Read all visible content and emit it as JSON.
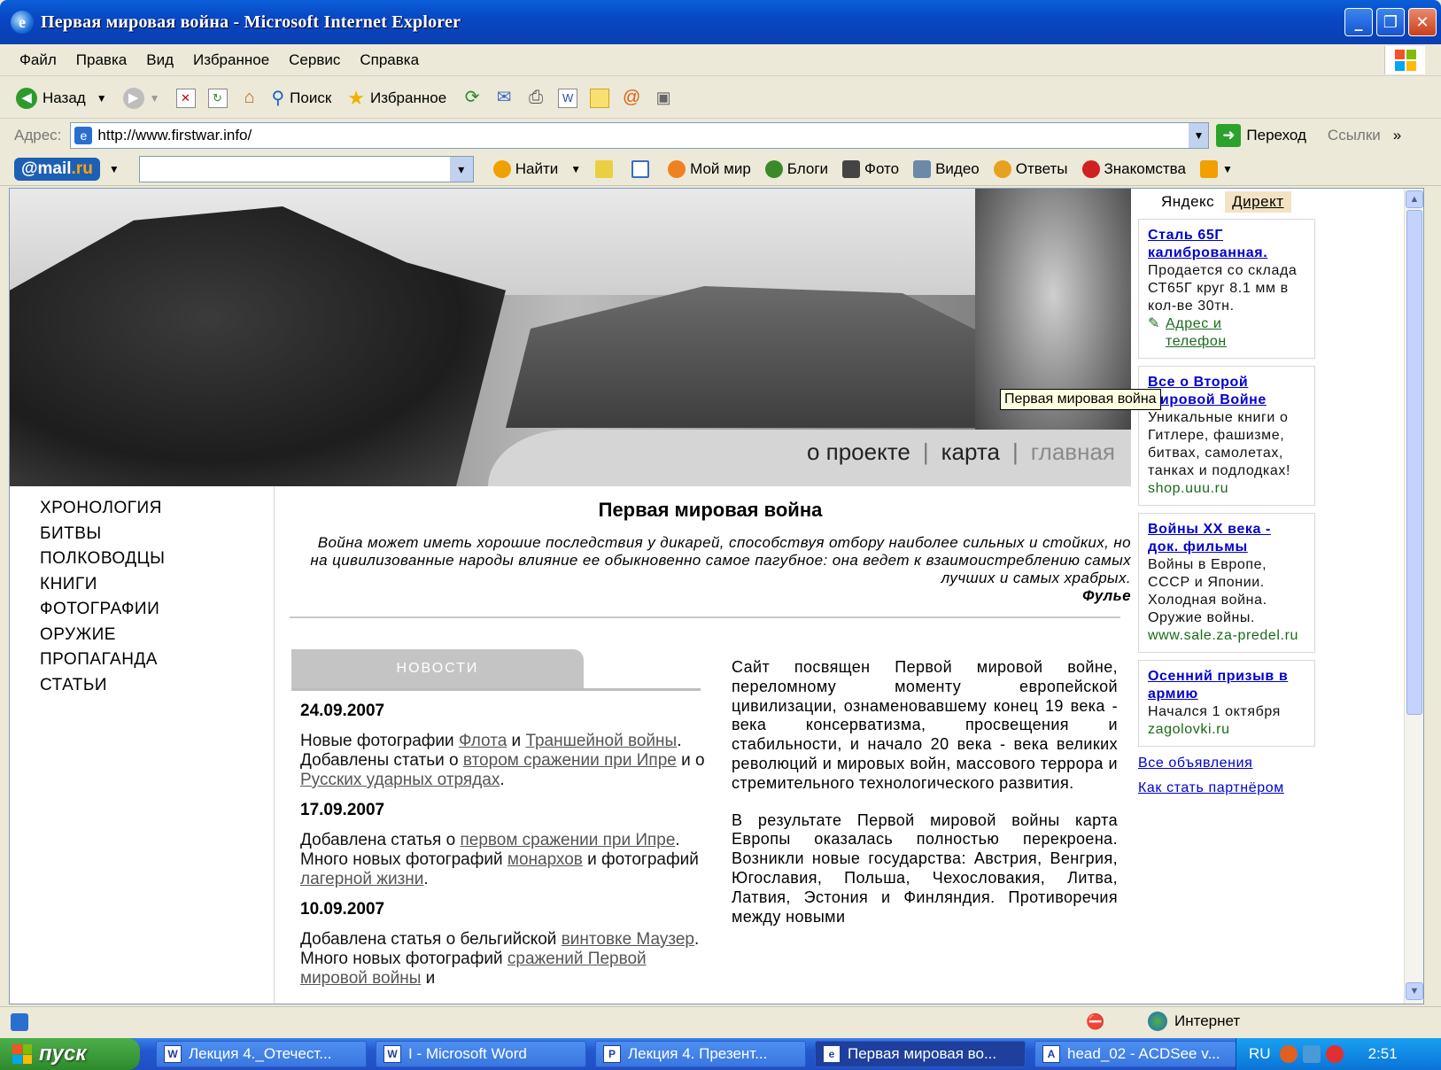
{
  "window": {
    "title": "Первая мировая война - Microsoft Internet Explorer"
  },
  "menu": [
    "Файл",
    "Правка",
    "Вид",
    "Избранное",
    "Сервис",
    "Справка"
  ],
  "toolbar": {
    "back": "Назад",
    "search": "Поиск",
    "favorites": "Избранное"
  },
  "address": {
    "label": "Адрес:",
    "url": "http://www.firstwar.info/",
    "go": "Переход",
    "links": "Ссылки"
  },
  "mailru": {
    "logo_at": "@mail",
    "logo_ru": ".ru",
    "find": "Найти",
    "items": [
      "Мой мир",
      "Блоги",
      "Фото",
      "Видео",
      "Ответы",
      "Знакомства"
    ]
  },
  "site": {
    "nav": {
      "about": "о проекте",
      "map": "карта",
      "home": "главная"
    },
    "tooltip": "Первая мировая война",
    "menu": [
      "ХРОНОЛОГИЯ",
      "БИТВЫ",
      "ПОЛКОВОДЦЫ",
      "КНИГИ",
      "ФОТОГРАФИИ",
      "ОРУЖИЕ",
      "ПРОПАГАНДА",
      "СТАТЬИ"
    ],
    "title": "Первая мировая война",
    "quote": "Война может иметь хорошие последствия у дикарей, способствуя отбору наиболее сильных и стойких, но на цивилизованные народы влияние ее обыкновенно самое пагубное: она ведет к взаимоистреблению самых лучших и самых храбрых.",
    "quote_author": "Фулье",
    "news_tab": "НОВОСТИ",
    "news": [
      {
        "date": "24.09.2007",
        "parts": [
          "Новые фотографии ",
          "Флота",
          " и ",
          "Траншейной войны",
          ". Добавлены статьи о ",
          "втором сражении при Ипре",
          " и о ",
          "Русских ударных отрядах",
          "."
        ]
      },
      {
        "date": "17.09.2007",
        "parts": [
          "Добавлена статья о ",
          "первом сражении при Ипре",
          ". Много новых фотографий ",
          "монархов",
          " и фотографий ",
          "лагерной жизни",
          "."
        ]
      },
      {
        "date": "10.09.2007",
        "parts": [
          "Добавлена статья о бельгийской ",
          "винтовке Маузер",
          ". Много новых фотографий ",
          "сражений Первой мировой войны",
          " и"
        ]
      }
    ],
    "article": [
      "Сайт посвящен Первой мировой войне, переломному моменту европейской цивилизации, ознаменовавшему конец 19 века - века консерватизма, просвещения и стабильности, и начало 20 века - века великих революций и мировых войн, массового террора и стремительного технологического развития.",
      "В результате Первой мировой войны карта Европы оказалась полностью перекроена. Возникли новые государства: Австрия, Венгрия, Югославия, Польша, Чехословакия, Литва, Латвия, Эстония и Финляндия. Противоречия между новыми"
    ]
  },
  "ads": {
    "yandex": "Яндекс",
    "direct": "Директ",
    "items": [
      {
        "title": "Сталь 65Г калиброванная.",
        "desc": "Продается со склада СТ65Г круг 8.1 мм в кол-ве 30тн.",
        "extra": "Адрес и телефон",
        "url": ""
      },
      {
        "title": "Все о Второй Мировой Войне",
        "desc": "Уникальные книги о Гитлере, фашизме, битвах, самолетах, танках и подлодках!",
        "extra": "",
        "url": "shop.uuu.ru"
      },
      {
        "title": "Войны XX века - док. фильмы",
        "desc": "Войны в Европе, СССР и Японии. Холодная война. Оружие войны.",
        "extra": "",
        "url": "www.sale.za-predel.ru"
      },
      {
        "title": "Осенний призыв в армию",
        "desc": "Начался 1 октября",
        "extra": "",
        "url": "zagolovki.ru"
      }
    ],
    "all": "Все объявления",
    "partner": "Как стать партнёром"
  },
  "status": {
    "zone": "Интернет"
  },
  "taskbar": {
    "start": "пуск",
    "tasks": [
      "Лекция 4._Отечест...",
      "I - Microsoft Word",
      "Лекция 4. Презент...",
      "Первая мировая во...",
      "head_02 - ACDSee v..."
    ],
    "lang": "RU",
    "time": "2:51"
  }
}
